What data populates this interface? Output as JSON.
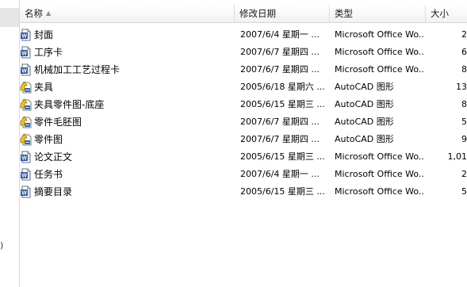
{
  "columns": {
    "name": "名称",
    "date": "修改日期",
    "type": "类型",
    "size": "大小"
  },
  "nav": {
    "edge_mark": ")"
  },
  "files": [
    {
      "name": "封面",
      "date": "2007/6/4 星期一 ...",
      "type": "Microsoft Office Wo...",
      "size": "2",
      "icon": "word-doc-icon"
    },
    {
      "name": "工序卡",
      "date": "2007/6/7 星期四 ...",
      "type": "Microsoft Office Wo...",
      "size": "6",
      "icon": "word-doc-icon"
    },
    {
      "name": "机械加工工艺过程卡",
      "date": "2007/6/7 星期四 ...",
      "type": "Microsoft Office Wo...",
      "size": "8",
      "icon": "word-doc-icon"
    },
    {
      "name": "夹具",
      "date": "2005/6/18 星期六 ...",
      "type": "AutoCAD 图形",
      "size": "13",
      "icon": "autocad-drawing-icon"
    },
    {
      "name": "夹具零件图-底座",
      "date": "2005/6/15 星期三 ...",
      "type": "AutoCAD 图形",
      "size": "8",
      "icon": "autocad-drawing-icon"
    },
    {
      "name": "零件毛胚图",
      "date": "2007/6/7 星期四 ...",
      "type": "AutoCAD 图形",
      "size": "5",
      "icon": "autocad-drawing-icon"
    },
    {
      "name": "零件图",
      "date": "2007/6/7 星期四 ...",
      "type": "AutoCAD 图形",
      "size": "9",
      "icon": "autocad-drawing-icon"
    },
    {
      "name": "论文正文",
      "date": "2005/6/15 星期三 ...",
      "type": "Microsoft Office Wo...",
      "size": "1,01",
      "icon": "word-doc-icon"
    },
    {
      "name": "任务书",
      "date": "2007/6/4 星期一 ...",
      "type": "Microsoft Office Wo...",
      "size": "2",
      "icon": "word-doc-icon"
    },
    {
      "name": "摘要目录",
      "date": "2005/6/15 星期三 ...",
      "type": "Microsoft Office Wo...",
      "size": "5",
      "icon": "word-doc-icon"
    }
  ]
}
